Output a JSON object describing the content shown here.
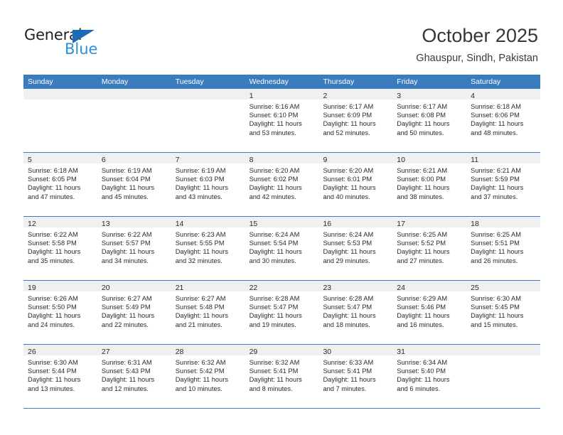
{
  "brand": {
    "name_top": "General",
    "name_bottom": "Blue",
    "accent_color": "#1b6cb5",
    "accent_light": "#2f8fd8"
  },
  "header": {
    "title": "October 2025",
    "subtitle": "Ghauspur, Sindh, Pakistan"
  },
  "theme": {
    "header_blue": "#3a7cbe",
    "day_band_gray": "#f0f0f0",
    "text_color": "#2a2a2a"
  },
  "weekdays": [
    "Sunday",
    "Monday",
    "Tuesday",
    "Wednesday",
    "Thursday",
    "Friday",
    "Saturday"
  ],
  "weeks": [
    [
      {
        "day": "",
        "lines": []
      },
      {
        "day": "",
        "lines": []
      },
      {
        "day": "",
        "lines": []
      },
      {
        "day": "1",
        "lines": [
          "Sunrise: 6:16 AM",
          "Sunset: 6:10 PM",
          "Daylight: 11 hours",
          "and 53 minutes."
        ]
      },
      {
        "day": "2",
        "lines": [
          "Sunrise: 6:17 AM",
          "Sunset: 6:09 PM",
          "Daylight: 11 hours",
          "and 52 minutes."
        ]
      },
      {
        "day": "3",
        "lines": [
          "Sunrise: 6:17 AM",
          "Sunset: 6:08 PM",
          "Daylight: 11 hours",
          "and 50 minutes."
        ]
      },
      {
        "day": "4",
        "lines": [
          "Sunrise: 6:18 AM",
          "Sunset: 6:06 PM",
          "Daylight: 11 hours",
          "and 48 minutes."
        ]
      }
    ],
    [
      {
        "day": "5",
        "lines": [
          "Sunrise: 6:18 AM",
          "Sunset: 6:05 PM",
          "Daylight: 11 hours",
          "and 47 minutes."
        ]
      },
      {
        "day": "6",
        "lines": [
          "Sunrise: 6:19 AM",
          "Sunset: 6:04 PM",
          "Daylight: 11 hours",
          "and 45 minutes."
        ]
      },
      {
        "day": "7",
        "lines": [
          "Sunrise: 6:19 AM",
          "Sunset: 6:03 PM",
          "Daylight: 11 hours",
          "and 43 minutes."
        ]
      },
      {
        "day": "8",
        "lines": [
          "Sunrise: 6:20 AM",
          "Sunset: 6:02 PM",
          "Daylight: 11 hours",
          "and 42 minutes."
        ]
      },
      {
        "day": "9",
        "lines": [
          "Sunrise: 6:20 AM",
          "Sunset: 6:01 PM",
          "Daylight: 11 hours",
          "and 40 minutes."
        ]
      },
      {
        "day": "10",
        "lines": [
          "Sunrise: 6:21 AM",
          "Sunset: 6:00 PM",
          "Daylight: 11 hours",
          "and 38 minutes."
        ]
      },
      {
        "day": "11",
        "lines": [
          "Sunrise: 6:21 AM",
          "Sunset: 5:59 PM",
          "Daylight: 11 hours",
          "and 37 minutes."
        ]
      }
    ],
    [
      {
        "day": "12",
        "lines": [
          "Sunrise: 6:22 AM",
          "Sunset: 5:58 PM",
          "Daylight: 11 hours",
          "and 35 minutes."
        ]
      },
      {
        "day": "13",
        "lines": [
          "Sunrise: 6:22 AM",
          "Sunset: 5:57 PM",
          "Daylight: 11 hours",
          "and 34 minutes."
        ]
      },
      {
        "day": "14",
        "lines": [
          "Sunrise: 6:23 AM",
          "Sunset: 5:55 PM",
          "Daylight: 11 hours",
          "and 32 minutes."
        ]
      },
      {
        "day": "15",
        "lines": [
          "Sunrise: 6:24 AM",
          "Sunset: 5:54 PM",
          "Daylight: 11 hours",
          "and 30 minutes."
        ]
      },
      {
        "day": "16",
        "lines": [
          "Sunrise: 6:24 AM",
          "Sunset: 5:53 PM",
          "Daylight: 11 hours",
          "and 29 minutes."
        ]
      },
      {
        "day": "17",
        "lines": [
          "Sunrise: 6:25 AM",
          "Sunset: 5:52 PM",
          "Daylight: 11 hours",
          "and 27 minutes."
        ]
      },
      {
        "day": "18",
        "lines": [
          "Sunrise: 6:25 AM",
          "Sunset: 5:51 PM",
          "Daylight: 11 hours",
          "and 26 minutes."
        ]
      }
    ],
    [
      {
        "day": "19",
        "lines": [
          "Sunrise: 6:26 AM",
          "Sunset: 5:50 PM",
          "Daylight: 11 hours",
          "and 24 minutes."
        ]
      },
      {
        "day": "20",
        "lines": [
          "Sunrise: 6:27 AM",
          "Sunset: 5:49 PM",
          "Daylight: 11 hours",
          "and 22 minutes."
        ]
      },
      {
        "day": "21",
        "lines": [
          "Sunrise: 6:27 AM",
          "Sunset: 5:48 PM",
          "Daylight: 11 hours",
          "and 21 minutes."
        ]
      },
      {
        "day": "22",
        "lines": [
          "Sunrise: 6:28 AM",
          "Sunset: 5:47 PM",
          "Daylight: 11 hours",
          "and 19 minutes."
        ]
      },
      {
        "day": "23",
        "lines": [
          "Sunrise: 6:28 AM",
          "Sunset: 5:47 PM",
          "Daylight: 11 hours",
          "and 18 minutes."
        ]
      },
      {
        "day": "24",
        "lines": [
          "Sunrise: 6:29 AM",
          "Sunset: 5:46 PM",
          "Daylight: 11 hours",
          "and 16 minutes."
        ]
      },
      {
        "day": "25",
        "lines": [
          "Sunrise: 6:30 AM",
          "Sunset: 5:45 PM",
          "Daylight: 11 hours",
          "and 15 minutes."
        ]
      }
    ],
    [
      {
        "day": "26",
        "lines": [
          "Sunrise: 6:30 AM",
          "Sunset: 5:44 PM",
          "Daylight: 11 hours",
          "and 13 minutes."
        ]
      },
      {
        "day": "27",
        "lines": [
          "Sunrise: 6:31 AM",
          "Sunset: 5:43 PM",
          "Daylight: 11 hours",
          "and 12 minutes."
        ]
      },
      {
        "day": "28",
        "lines": [
          "Sunrise: 6:32 AM",
          "Sunset: 5:42 PM",
          "Daylight: 11 hours",
          "and 10 minutes."
        ]
      },
      {
        "day": "29",
        "lines": [
          "Sunrise: 6:32 AM",
          "Sunset: 5:41 PM",
          "Daylight: 11 hours",
          "and 8 minutes."
        ]
      },
      {
        "day": "30",
        "lines": [
          "Sunrise: 6:33 AM",
          "Sunset: 5:41 PM",
          "Daylight: 11 hours",
          "and 7 minutes."
        ]
      },
      {
        "day": "31",
        "lines": [
          "Sunrise: 6:34 AM",
          "Sunset: 5:40 PM",
          "Daylight: 11 hours",
          "and 6 minutes."
        ]
      },
      {
        "day": "",
        "lines": []
      }
    ]
  ]
}
